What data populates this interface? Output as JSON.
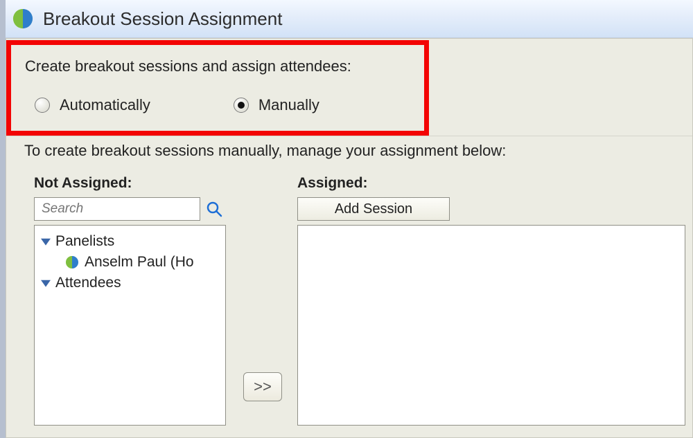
{
  "window": {
    "title": "Breakout Session Assignment"
  },
  "section": {
    "heading": "Create breakout sessions and assign attendees:",
    "radio_auto": "Automatically",
    "radio_manual": "Manually",
    "selected": "manual"
  },
  "instruction": "To create breakout sessions manually, manage your assignment below:",
  "left": {
    "header": "Not Assigned:",
    "search_placeholder": "Search",
    "groups": [
      {
        "label": "Panelists",
        "children": [
          {
            "name": "Anselm Paul (Ho"
          }
        ]
      },
      {
        "label": "Attendees",
        "children": []
      }
    ]
  },
  "mid": {
    "move_right_label": ">>"
  },
  "right": {
    "header": "Assigned:",
    "add_session_label": "Add Session"
  }
}
